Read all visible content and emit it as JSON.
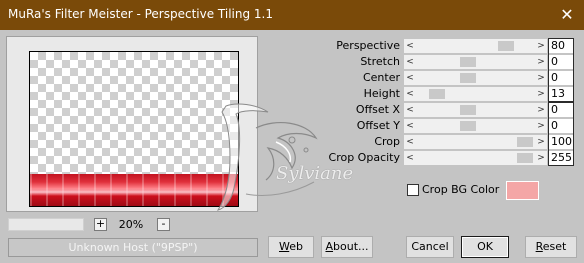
{
  "window": {
    "title": "MuRa's Filter Meister - Perspective Tiling 1.1",
    "close_glyph": "✕"
  },
  "preview": {
    "zoom_plus": "+",
    "zoom_value": "20%",
    "zoom_minus": "-",
    "status": "Unknown Host (\"9PSP\")"
  },
  "watermark": {
    "text": "Sylviane"
  },
  "params": [
    {
      "label": "Perspective",
      "value": "80",
      "position": 0.8
    },
    {
      "label": "Stretch",
      "value": "0",
      "position": 0.43
    },
    {
      "label": "Center",
      "value": "0",
      "position": 0.43
    },
    {
      "label": "Height",
      "value": "13",
      "position": 0.13
    },
    {
      "label": "Offset X",
      "value": "0",
      "position": 0.43
    },
    {
      "label": "Offset Y",
      "value": "0",
      "position": 0.43
    },
    {
      "label": "Crop",
      "value": "100",
      "position": 0.98
    },
    {
      "label": "Crop Opacity",
      "value": "255",
      "position": 0.98
    }
  ],
  "crop_bg": {
    "label": "Crop BG Color",
    "checked": false,
    "color": "#f4a6a6"
  },
  "buttons": {
    "web": {
      "label": "Web",
      "mnemonic": "W",
      "rest": "eb"
    },
    "about": {
      "label": "About...",
      "mnemonic": "A",
      "rest": "bout..."
    },
    "cancel": {
      "label": "Cancel"
    },
    "ok": {
      "label": "OK"
    },
    "reset": {
      "label": "Reset",
      "mnemonic": "R",
      "rest": "eset"
    }
  },
  "colors": {
    "titlebar": "#7a4a09",
    "dialog_bg": "#c4c4c4",
    "floor_red": "#d9111e",
    "crop_bg_swatch": "#f4a6a6"
  }
}
